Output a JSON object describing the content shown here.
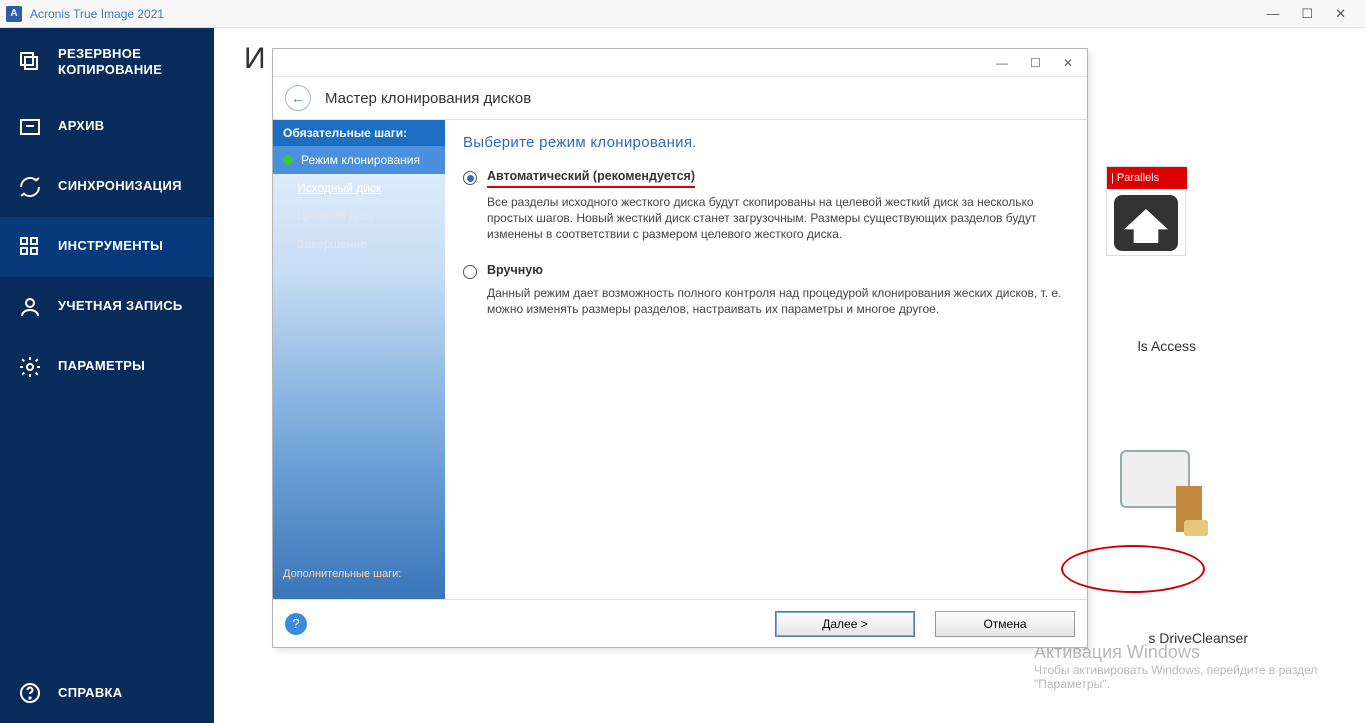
{
  "titlebar": {
    "app_name": "Acronis True Image 2021",
    "icon_letter": "A"
  },
  "sidebar": {
    "items": [
      {
        "label": "РЕЗЕРВНОЕ КОПИРОВАНИЕ",
        "name": "backup"
      },
      {
        "label": "АРХИВ",
        "name": "archive"
      },
      {
        "label": "СИНХРОНИЗАЦИЯ",
        "name": "sync"
      },
      {
        "label": "ИНСТРУМЕНТЫ",
        "name": "tools"
      },
      {
        "label": "УЧЕТНАЯ ЗАПИСЬ",
        "name": "account"
      },
      {
        "label": "ПАРАМЕТРЫ",
        "name": "settings"
      }
    ],
    "help": "СПРАВКА"
  },
  "main": {
    "heading": "И"
  },
  "parallels": {
    "tag": "| Parallels",
    "access": "ls Access",
    "drivecleanser": "s DriveCleanser"
  },
  "activation": {
    "title": "Активация Windows",
    "sub": "Чтобы активировать Windows, перейдите в раздел \"Параметры\"."
  },
  "dialog": {
    "header": "Мастер клонирования дисков",
    "side_header": "Обязательные шаги:",
    "steps": [
      {
        "label": "Режим клонирования",
        "state": "current"
      },
      {
        "label": "Исходный диск",
        "state": "next"
      },
      {
        "label": "Целевой диск",
        "state": "pending"
      },
      {
        "label": "Завершение",
        "state": "pending"
      }
    ],
    "side_footer": "Дополнительные шаги:",
    "main_title": "Выберите режим клонирования.",
    "opt1_label": "Автоматический (рекомендуется)",
    "opt1_desc": "Все разделы исходного жесткого диска будут скопированы на целевой жесткий диск за несколько простых шагов. Новый жесткий диск станет загрузочным. Размеры существующих разделов будут изменены в соответствии с размером целевого жесткого диска.",
    "opt2_label": "Вручную",
    "opt2_desc": "Данный режим дает возможность полного контроля над процедурой клонирования жеских дисков, т. е. можно изменять размеры разделов, настраивать их параметры и многое другое.",
    "btn_next": "Далее >",
    "btn_cancel": "Отмена"
  }
}
